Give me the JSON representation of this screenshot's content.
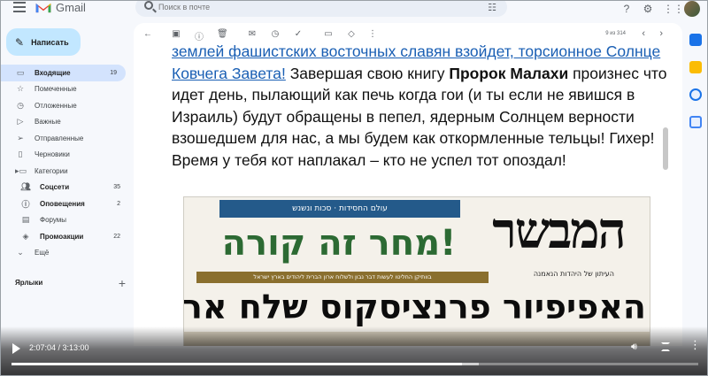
{
  "app": {
    "name": "Gmail",
    "colors": {
      "accent": "#c2e7ff",
      "active_nav": "#d3e3fd",
      "link": "#1a5fb4"
    }
  },
  "search": {
    "placeholder": "Поиск в почте"
  },
  "compose": {
    "label": "Написать"
  },
  "sidebar": {
    "items": [
      {
        "label": "Входящие",
        "count": "19",
        "icon": "inbox-icon"
      },
      {
        "label": "Помеченные",
        "icon": "star-icon"
      },
      {
        "label": "Отложенные",
        "icon": "clock-icon"
      },
      {
        "label": "Важные",
        "icon": "label-important-icon"
      },
      {
        "label": "Отправленные",
        "icon": "send-icon"
      },
      {
        "label": "Черновики",
        "icon": "draft-icon"
      },
      {
        "label": "Категории",
        "icon": "category-icon"
      },
      {
        "label": "Соцсети",
        "count": "35",
        "icon": "people-icon"
      },
      {
        "label": "Оповещения",
        "count": "2",
        "icon": "info-icon"
      },
      {
        "label": "Форумы",
        "icon": "forum-icon"
      },
      {
        "label": "Промоакции",
        "count": "22",
        "icon": "tag-icon"
      },
      {
        "label": "Ещё",
        "icon": "chevron-down-icon"
      }
    ],
    "labels_title": "Ярлыки"
  },
  "toolbar": {
    "pager": "9 из 314"
  },
  "message": {
    "link_text": "землей фашистских восточных славян взойдет, торсионное Солнце Ковчега Завета!",
    "text_1": " Завершая свою книгу ",
    "bold_1": "Пророк Малахи",
    "text_2": " произнес что идет день, пылающий как печь когда гои (и ты если не явишся в Израиль) будут обращены в пепел, ядерным Солнцем верности взошедшем для нас, а мы будем как откормленные тельцы! Гихер! Время у тебя кот наплакал – кто не успел тот опоздал!"
  },
  "newspaper": {
    "masthead": "המבשר",
    "masthead_sub": "העיתון של היהדות הנאמנה",
    "band": "עולם החסידות · סכות ונשנש",
    "headline": "!מחר זה קורה",
    "strip": "בוותיקן החליטו לעשות דבר נבון ולשלוח ארון הברית ליהודים בארץ ישראל",
    "big_headline": "האפיפיור פרנציסקוס שלח ארון הברית לארץ ישראל"
  },
  "video": {
    "time": "2:07:04 / 3:13:00",
    "progress": 0.6564,
    "buffered": 0.68
  }
}
